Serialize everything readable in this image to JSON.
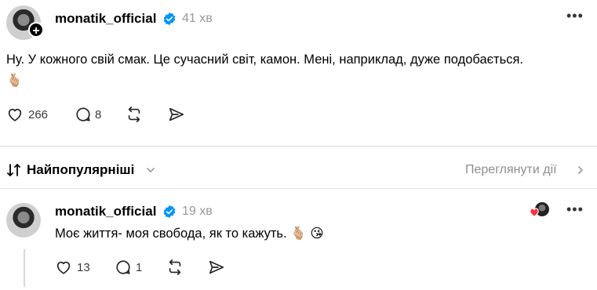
{
  "post": {
    "username": "monatik_official",
    "time": "41 хв",
    "text": "Ну. У кожного свій смак. Це сучасний світ, камон. Мені, наприклад, дуже подобається.",
    "emoji": "🫰🏼",
    "likes": "266",
    "replies": "8"
  },
  "sort": {
    "label": "Найпопулярніші",
    "review_link": "Переглянути дії"
  },
  "reply": {
    "username": "monatik_official",
    "time": "19 хв",
    "text": "Моє життя- моя свобода, як то кажуть.",
    "emoji": "🫰🏼 😘",
    "likes": "13",
    "replies": "1"
  },
  "icons": {
    "verified": "verified-badge-icon",
    "like": "heart-icon",
    "reply": "comment-icon",
    "repost": "repost-icon",
    "share": "send-icon",
    "more": "more-icon",
    "sort": "sort-arrows-icon",
    "chevron_down": "chevron-down-icon",
    "chevron_right": "chevron-right-icon",
    "liked_by_author": "liked-by-author-icon"
  },
  "colors": {
    "verified": "#0095f6",
    "heart": "#ff3040",
    "muted": "#999999"
  }
}
